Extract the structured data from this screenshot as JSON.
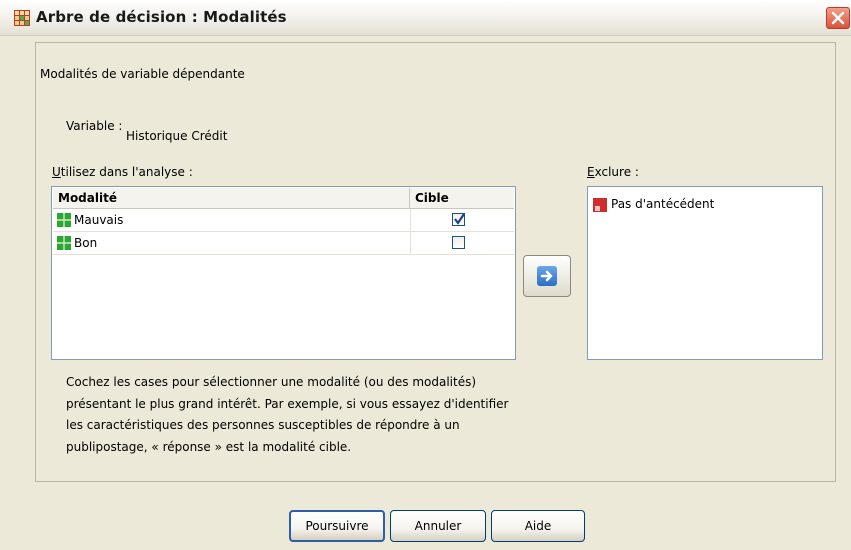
{
  "window": {
    "title": "Arbre de décision : Modalités",
    "close_icon": "close-icon"
  },
  "group": {
    "legend": "Modalités de variable dépendante"
  },
  "variable": {
    "label": "Variable :",
    "value": "Historique Crédit"
  },
  "use_list": {
    "label_underlined": "U",
    "label_rest": "tilisez dans l'analyse :",
    "columns": [
      "Modalité",
      "Cible"
    ],
    "rows": [
      {
        "name": "Mauvais",
        "icon": "category-icon",
        "target": true
      },
      {
        "name": "Bon",
        "icon": "category-icon",
        "target": false
      }
    ]
  },
  "move_button": {
    "icon": "arrow-right-icon"
  },
  "exclude_list": {
    "label_underlined": "E",
    "label_rest": "xclure :",
    "items": [
      {
        "name": "Pas d'antécédent",
        "icon": "excluded-category-icon"
      }
    ]
  },
  "info_text": "Cochez les cases pour sélectionner une modalité (ou des modalités) présentant le plus grand intérêt. Par exemple, si vous essayez d'identifier les caractéristiques des personnes susceptibles de répondre à un publipostage, « réponse » est la modalité cible.",
  "buttons": {
    "continue": "Poursuivre",
    "cancel": "Annuler",
    "help": "Aide"
  },
  "colors": {
    "dialog_bg": "#ece9d8",
    "list_border": "#7f9db9",
    "category_green": "#2fa534",
    "excluded_red": "#d22d2d"
  }
}
